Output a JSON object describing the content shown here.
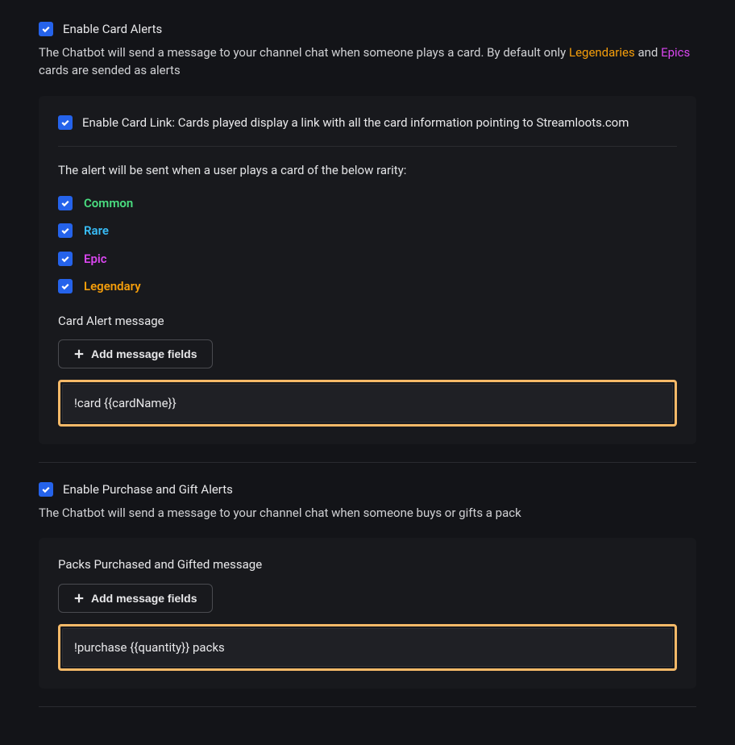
{
  "cardAlerts": {
    "enableLabel": "Enable Card Alerts",
    "descPrefix": "The Chatbot will send a message to your channel chat when someone plays a card. By default only ",
    "descLegendaries": "Legendaries",
    "descAnd": " and ",
    "descEpics": "Epics",
    "descSuffix": " cards are sended as alerts",
    "cardLinkLabel": "Enable Card Link: Cards played display a link with all the card information pointing to Streamloots.com",
    "rarityIntro": "The alert will be sent when a user plays a card of the below rarity:",
    "rarities": {
      "common": "Common",
      "rare": "Rare",
      "epic": "Epic",
      "legendary": "Legendary"
    },
    "messageLabel": "Card Alert message",
    "addFieldsLabel": "Add message fields",
    "messageValue": "!card {{cardName}}"
  },
  "purchaseAlerts": {
    "enableLabel": "Enable Purchase and Gift Alerts",
    "desc": "The Chatbot will send a message to your channel chat when someone buys or gifts a pack",
    "messageLabel": "Packs Purchased and Gifted message",
    "addFieldsLabel": "Add message fields",
    "messageValue": "!purchase {{quantity}} packs"
  }
}
